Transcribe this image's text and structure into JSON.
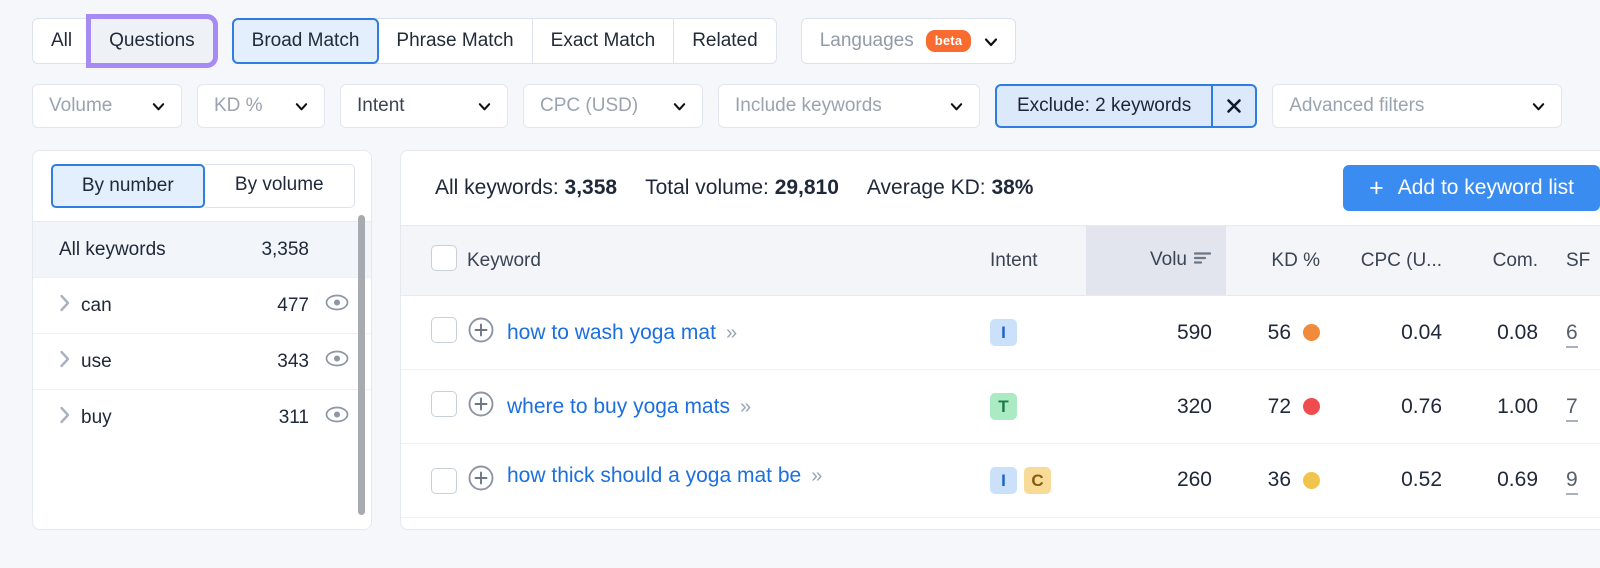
{
  "match_tabs": {
    "group1": [
      {
        "label": "All",
        "state": "normal"
      },
      {
        "label": "Questions",
        "state": "highlighted"
      }
    ],
    "group2": [
      {
        "label": "Broad Match",
        "state": "active"
      },
      {
        "label": "Phrase Match",
        "state": "normal"
      },
      {
        "label": "Exact Match",
        "state": "normal"
      },
      {
        "label": "Related",
        "state": "normal"
      }
    ],
    "languages": {
      "label": "Languages",
      "badge": "beta"
    }
  },
  "filters": [
    {
      "label": "Volume",
      "active": false
    },
    {
      "label": "KD %",
      "active": false
    },
    {
      "label": "Intent",
      "active": false
    },
    {
      "label": "CPC (USD)",
      "active": false
    },
    {
      "label": "Include keywords",
      "active": false
    }
  ],
  "exclude_filter": {
    "label": "Exclude: 2 keywords",
    "clear": "✕"
  },
  "advanced_filters": {
    "label": "Advanced filters"
  },
  "sidebar": {
    "toggle": {
      "by_number": "By number",
      "by_volume": "By volume",
      "selected": "By number"
    },
    "all_keywords": {
      "label": "All keywords",
      "count": "3,358"
    },
    "groups": [
      {
        "label": "can",
        "count": "477"
      },
      {
        "label": "use",
        "count": "343"
      },
      {
        "label": "buy",
        "count": "311"
      }
    ]
  },
  "summary": {
    "all_keywords_label": "All keywords:",
    "all_keywords_value": "3,358",
    "total_volume_label": "Total volume:",
    "total_volume_value": "29,810",
    "average_kd_label": "Average KD:",
    "average_kd_value": "38%",
    "add_button": "Add to keyword list",
    "add_button_icon": "+"
  },
  "table": {
    "headers": {
      "keyword": "Keyword",
      "intent": "Intent",
      "volume": "Volu",
      "kd": "KD %",
      "cpc": "CPC (U...",
      "com": "Com.",
      "sf": "SF"
    },
    "rows": [
      {
        "keyword": "how to wash yoga mat",
        "intents": [
          "I"
        ],
        "volume": "590",
        "kd": "56",
        "kd_color": "#f08a3c",
        "cpc": "0.04",
        "com": "0.08",
        "sf": "6"
      },
      {
        "keyword": "where to buy yoga mats",
        "intents": [
          "T"
        ],
        "volume": "320",
        "kd": "72",
        "kd_color": "#ef4d4d",
        "cpc": "0.76",
        "com": "1.00",
        "sf": "7"
      },
      {
        "keyword": "how thick should a yoga mat be",
        "intents": [
          "I",
          "C"
        ],
        "volume": "260",
        "kd": "36",
        "kd_color": "#f2c44d",
        "cpc": "0.52",
        "com": "0.69",
        "sf": "9"
      }
    ]
  },
  "colors": {
    "accent_blue": "#3b8cf0",
    "link_blue": "#1c6fe0",
    "highlight_purple": "#a78bf5",
    "beta_orange": "#f96b2f"
  }
}
